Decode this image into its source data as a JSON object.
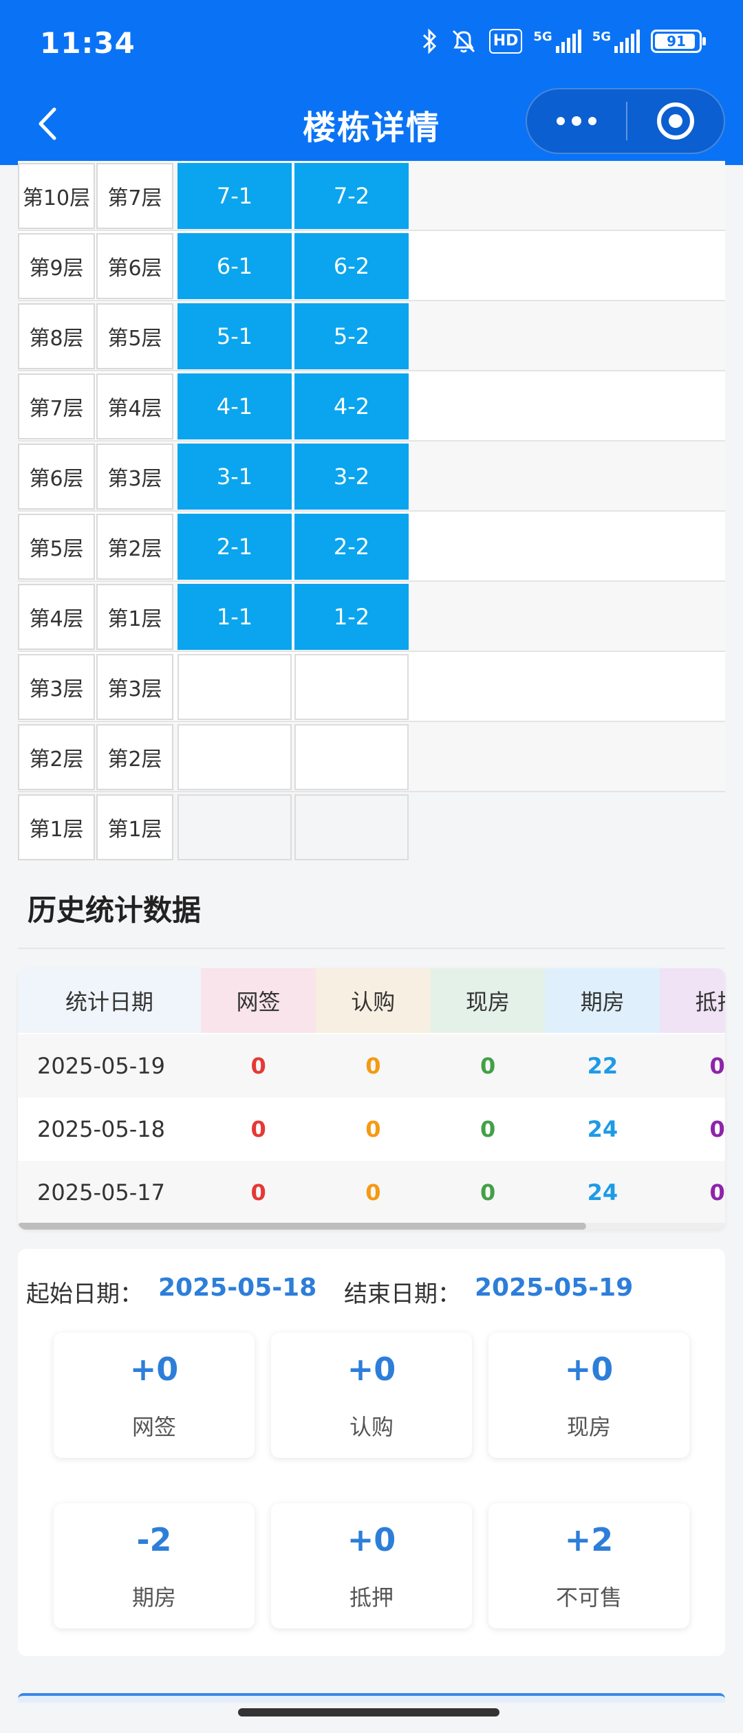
{
  "status_bar": {
    "time": "11:34",
    "battery": "91",
    "hd": "HD",
    "net1": "5G",
    "net2": "5G"
  },
  "nav": {
    "title": "楼栋详情"
  },
  "floors": [
    {
      "f1": "第10层",
      "f2": "第7层",
      "u1": "7-1",
      "u2": "7-2"
    },
    {
      "f1": "第9层",
      "f2": "第6层",
      "u1": "6-1",
      "u2": "6-2"
    },
    {
      "f1": "第8层",
      "f2": "第5层",
      "u1": "5-1",
      "u2": "5-2"
    },
    {
      "f1": "第7层",
      "f2": "第4层",
      "u1": "4-1",
      "u2": "4-2"
    },
    {
      "f1": "第6层",
      "f2": "第3层",
      "u1": "3-1",
      "u2": "3-2"
    },
    {
      "f1": "第5层",
      "f2": "第2层",
      "u1": "2-1",
      "u2": "2-2"
    },
    {
      "f1": "第4层",
      "f2": "第1层",
      "u1": "1-1",
      "u2": "1-2"
    },
    {
      "f1": "第3层",
      "f2": "第3层",
      "u1": "",
      "u2": ""
    },
    {
      "f1": "第2层",
      "f2": "第2层",
      "u1": "",
      "u2": ""
    },
    {
      "f1": "第1层",
      "f2": "第1层",
      "u1": "",
      "u2": ""
    }
  ],
  "history": {
    "title": "历史统计数据",
    "headers": [
      "统计日期",
      "网签",
      "认购",
      "现房",
      "期房",
      "抵押"
    ],
    "rows": [
      {
        "date": "2025-05-19",
        "wangqian": "0",
        "rengou": "0",
        "xianfang": "0",
        "qifang": "22",
        "diya": "0"
      },
      {
        "date": "2025-05-18",
        "wangqian": "0",
        "rengou": "0",
        "xianfang": "0",
        "qifang": "24",
        "diya": "0"
      },
      {
        "date": "2025-05-17",
        "wangqian": "0",
        "rengou": "0",
        "xianfang": "0",
        "qifang": "24",
        "diya": "0"
      }
    ]
  },
  "compare": {
    "start_label": "起始日期：",
    "start_date": "2025-05-18",
    "end_label": "结束日期：",
    "end_date": "2025-05-19",
    "stats": [
      {
        "value": "+0",
        "label": "网签"
      },
      {
        "value": "+0",
        "label": "认购"
      },
      {
        "value": "+0",
        "label": "现房"
      },
      {
        "value": "-2",
        "label": "期房"
      },
      {
        "value": "+0",
        "label": "抵押"
      },
      {
        "value": "+2",
        "label": "不可售"
      }
    ]
  },
  "colors": {
    "primary": "#0a73f5",
    "unit_fill": "#0aa5ee",
    "wangqian": "#e53935",
    "rengou": "#f59a12",
    "xianfang": "#43a047",
    "qifang": "#1e9be6",
    "diya": "#8e24aa",
    "stat_value": "#2d7ed9"
  }
}
